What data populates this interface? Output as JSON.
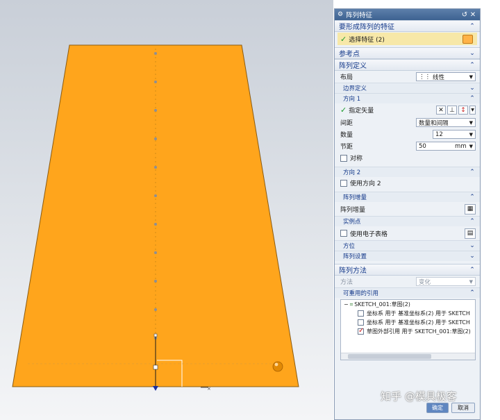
{
  "dialog": {
    "title": "阵列特征",
    "section_features": {
      "label": "要形成阵列的特征",
      "select_label": "选择特征 (2)"
    },
    "section_reference": {
      "label": "参考点"
    },
    "section_definition": {
      "label": "阵列定义",
      "layout_label": "布局",
      "layout_value": "线性",
      "boundary_label": "边界定义",
      "direction1": {
        "label": "方向 1",
        "vector_label": "指定矢量",
        "spacing_label": "间距",
        "spacing_value": "数量和间隔",
        "count_label": "数量",
        "count_value": "12",
        "pitch_label": "节距",
        "pitch_value": "50",
        "pitch_unit": "mm",
        "symmetric_label": "对称"
      },
      "direction2": {
        "label": "方向 2",
        "use_label": "使用方向 2"
      },
      "increment": {
        "head_label": "阵列增量",
        "row_label": "阵列增量"
      },
      "instance": {
        "head_label": "实例点",
        "spreadsheet_label": "使用电子表格"
      },
      "orientation_label": "方位",
      "settings_label": "阵列设置"
    },
    "section_method": {
      "label": "阵列方法",
      "method_label": "方法",
      "method_value": "变化",
      "reusable_label": "可重用的引用",
      "tree": {
        "root": "SKETCH_001:草图(2)",
        "items": [
          {
            "label": "坐标系 用于 基准坐标系(2) 用于 SKETCH",
            "checked": false
          },
          {
            "label": "坐标系 用于 基准坐标系(2) 用于 SKETCH",
            "checked": false
          },
          {
            "label": "草图外部引用 用于 SKETCH_001:草图(2)",
            "checked": true
          }
        ]
      }
    },
    "buttons": {
      "ok": "确定",
      "cancel": "取消"
    }
  },
  "watermark": "知乎 @模具极客",
  "colors": {
    "accent": "#14398a",
    "plate": "#ffa51c",
    "title_bar": "#3d6291"
  }
}
